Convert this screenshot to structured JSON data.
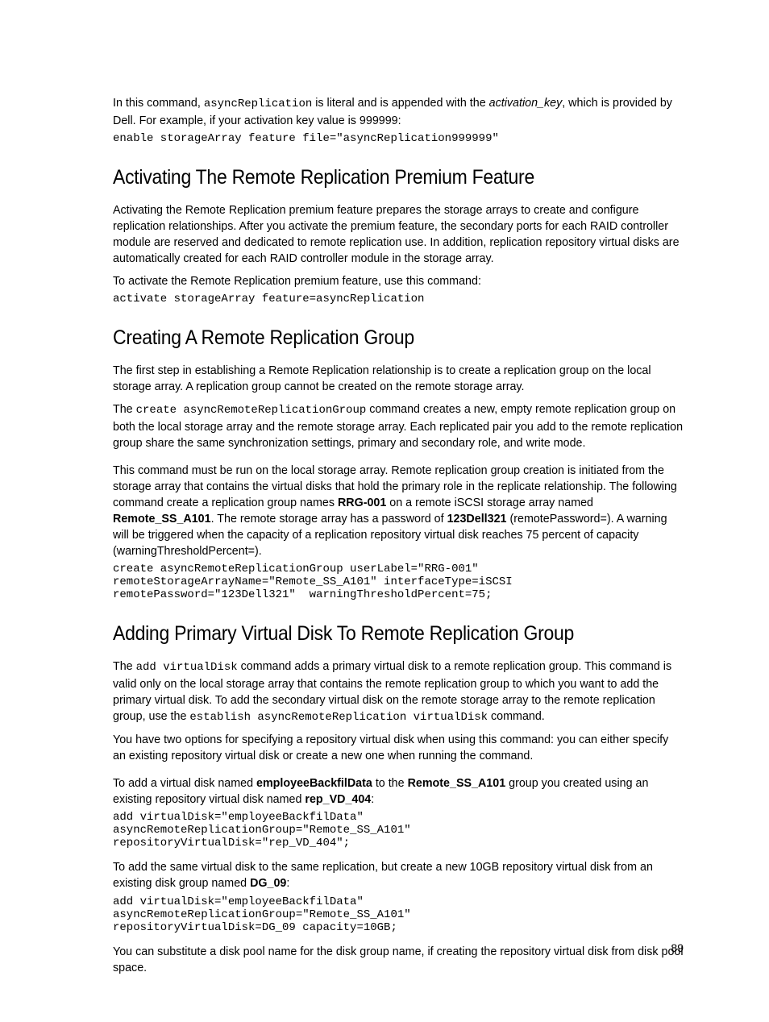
{
  "p1_a": "In this command, ",
  "p1_b": "asyncReplication",
  "p1_c": " is literal and is appended with the ",
  "p1_d": "activation_key",
  "p1_e": ", which is provided by Dell. For example, if your activation key value is 999999:",
  "code1": "enable storageArray feature file=\"asyncReplication999999\"",
  "h2_1": "Activating The Remote Replication Premium Feature",
  "p2": "Activating the Remote Replication premium feature prepares the storage arrays to create and configure replication relationships. After you activate the premium feature, the secondary ports for each RAID controller module are reserved and dedicated to remote replication use. In addition, replication repository virtual disks are automatically created for each RAID controller module in the storage array.",
  "p3": "To activate the Remote Replication premium feature, use this command:",
  "code2": "activate storageArray feature=asyncReplication",
  "h2_2": "Creating A Remote Replication Group",
  "p4": "The first step in establishing a Remote Replication relationship is to create a replication group on the local storage array. A replication group cannot be created on the remote storage array.",
  "p5_a": "The ",
  "p5_b": "create asyncRemoteReplicationGroup",
  "p5_c": " command creates a new, empty remote replication group on both the local storage array and the remote storage array. Each replicated pair you add to the remote replication group share the same synchronization settings, primary and secondary role, and write mode.",
  "p6_a": "This command must be run on the local storage array. Remote replication group creation is initiated from the storage array that contains the virtual disks that hold the primary role in the replicate relationship. The following command create a replication group names ",
  "p6_b": "RRG-001",
  "p6_c": " on a remote iSCSI storage array named ",
  "p6_d": "Remote_SS_A101",
  "p6_e": ". The remote storage array has a password of ",
  "p6_f": "123Dell321",
  "p6_g": " (remotePassword=). A warning will be triggered when the capacity of a replication repository virtual disk reaches 75 percent of capacity (warningThresholdPercent=).",
  "code3": "create asyncRemoteReplicationGroup userLabel=\"RRG-001\" \nremoteStorageArrayName=\"Remote_SS_A101\" interfaceType=iSCSI \nremotePassword=\"123Dell321\"  warningThresholdPercent=75;",
  "h2_3": "Adding Primary Virtual Disk To Remote Replication Group",
  "p7_a": "The ",
  "p7_b": "add virtualDisk",
  "p7_c": " command adds a primary virtual disk to a remote replication group. This command is valid only on the local storage array that contains the remote replication group to which you want to add the primary virtual disk. To add the secondary virtual disk on the remote storage array to the remote replication group, use the ",
  "p7_d": "establish asyncRemoteReplication virtualDisk",
  "p7_e": " command.",
  "p8": "You have two options for specifying a repository virtual disk when using this command: you can either specify an existing repository virtual disk or create a new one when running the command.",
  "p9_a": "To add a virtual disk named ",
  "p9_b": "employeeBackfilData",
  "p9_c": " to the ",
  "p9_d": "Remote_SS_A101",
  "p9_e": " group you created using an existing repository virtual disk named ",
  "p9_f": "rep_VD_404",
  "p9_g": ":",
  "code4": "add virtualDisk=\"employeeBackfilData\" \nasyncRemoteReplicationGroup=\"Remote_SS_A101\" \nrepositoryVirtualDisk=\"rep_VD_404\";",
  "p10_a": "To add the same virtual disk to the same replication, but create a new 10GB repository virtual disk from an existing disk group named ",
  "p10_b": "DG_09",
  "p10_c": ":",
  "code5": "add virtualDisk=\"employeeBackfilData\" \nasyncRemoteReplicationGroup=\"Remote_SS_A101\" \nrepositoryVirtualDisk=DG_09 capacity=10GB;",
  "p11": "You can substitute a disk pool name for the disk group name, if creating the repository virtual disk from disk pool space.",
  "page_number": "89"
}
